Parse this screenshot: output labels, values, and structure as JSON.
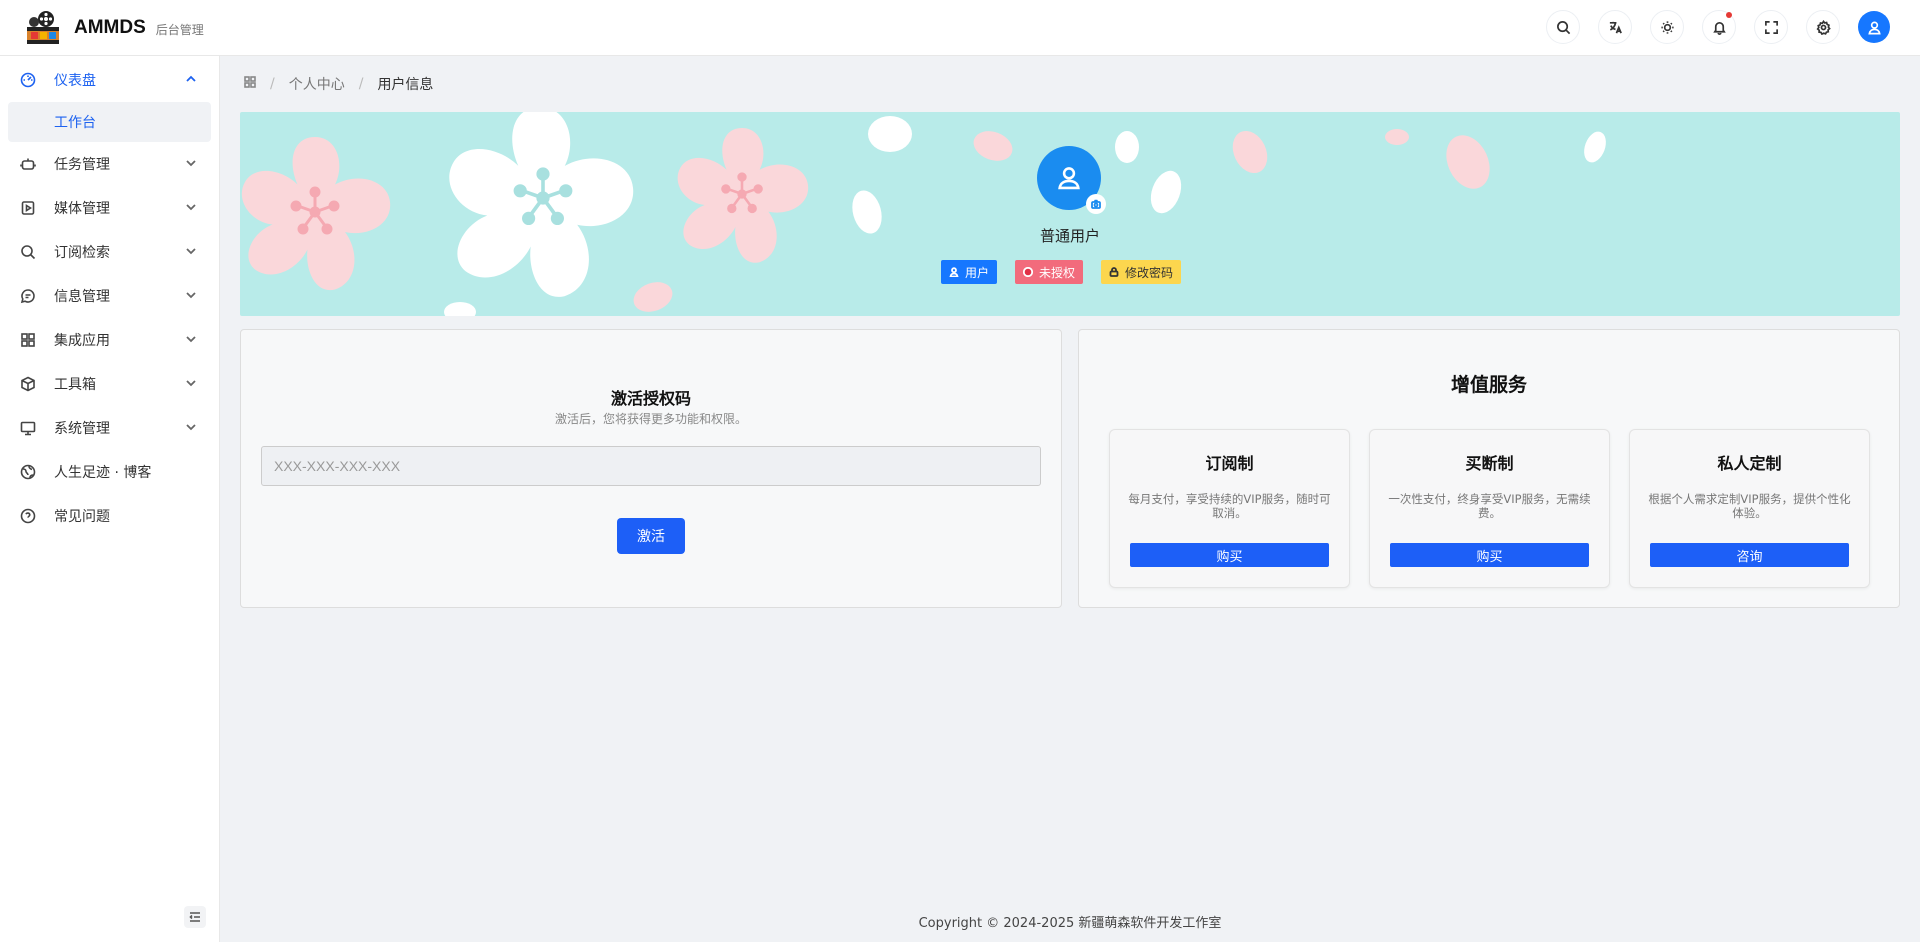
{
  "header": {
    "brand": "AMMDS",
    "brand_sub": "后台管理",
    "tools": [
      "search-icon",
      "translate-icon",
      "theme-icon",
      "bell-icon",
      "fullscreen-icon",
      "settings-icon",
      "user-icon"
    ]
  },
  "sidebar": {
    "items": [
      {
        "label": "仪表盘",
        "icon": "dashboard-icon",
        "expanded": true
      },
      {
        "label": "任务管理",
        "icon": "robot-icon"
      },
      {
        "label": "媒体管理",
        "icon": "media-icon"
      },
      {
        "label": "订阅检索",
        "icon": "search-icon"
      },
      {
        "label": "信息管理",
        "icon": "message-icon"
      },
      {
        "label": "集成应用",
        "icon": "apps-icon"
      },
      {
        "label": "工具箱",
        "icon": "box-icon"
      },
      {
        "label": "系统管理",
        "icon": "monitor-icon"
      },
      {
        "label": "人生足迹 · 博客",
        "icon": "globe-icon"
      },
      {
        "label": "常见问题",
        "icon": "help-icon"
      }
    ],
    "sub_active": "工作台"
  },
  "breadcrumb": {
    "items": [
      "个人中心",
      "用户信息"
    ]
  },
  "profile": {
    "name": "普通用户",
    "tags": {
      "user": "用户",
      "unauth": "未授权",
      "pwd": "修改密码"
    }
  },
  "activation": {
    "title": "激活授权码",
    "subtitle": "激活后，您将获得更多功能和权限。",
    "placeholder": "XXX-XXX-XXX-XXX",
    "button": "激活"
  },
  "vas": {
    "title": "增值服务",
    "plans": [
      {
        "name": "订阅制",
        "desc": "每月支付，享受持续的VIP服务，随时可取消。",
        "button": "购买"
      },
      {
        "name": "买断制",
        "desc": "一次性支付，终身享受VIP服务，无需续费。",
        "button": "购买"
      },
      {
        "name": "私人定制",
        "desc": "根据个人需求定制VIP服务，提供个性化体验。",
        "button": "咨询"
      }
    ]
  },
  "footer": "Copyright © 2024-2025 新疆萌森软件开发工作室",
  "colors": {
    "primary": "#1d5ff7",
    "banner_bg": "#b8ebe9",
    "avatar": "#1a8cf0",
    "tag_unauth": "#f26b7c",
    "tag_pwd": "#fcd64e"
  }
}
